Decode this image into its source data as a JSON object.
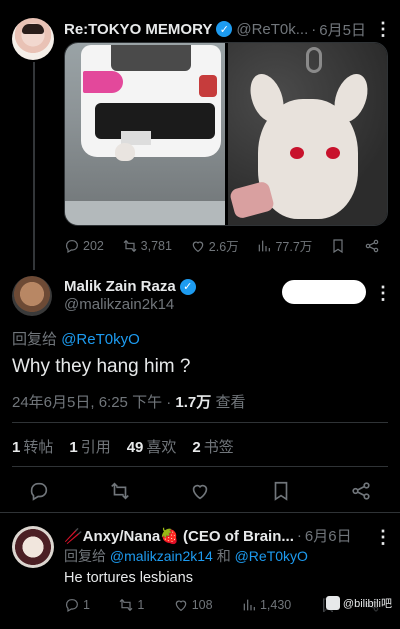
{
  "top_tweet": {
    "name": "Re:TOKYO MEMORY",
    "handle": "@ReT0k...",
    "date": "6月5日",
    "replies": "202",
    "retweets": "3,781",
    "likes": "2.6万",
    "views": "77.7万"
  },
  "main_tweet": {
    "name": "Malik Zain Raza",
    "handle": "@malikzain2k14",
    "reply_prefix": "回复给",
    "reply_to": "@ReT0kyO",
    "text": "Why they hang him ?",
    "timestamp": "24年6月5日, 6:25 下午",
    "views_count": "1.7万",
    "views_label": "查看",
    "stats": [
      {
        "count": "1",
        "label": "转帖"
      },
      {
        "count": "1",
        "label": "引用"
      },
      {
        "count": "49",
        "label": "喜欢"
      },
      {
        "count": "2",
        "label": "书签"
      }
    ]
  },
  "reply_tweet": {
    "name": "🥢Anxy/Nana🍓 (CEO of Brain...",
    "date": "6月6日",
    "reply_prefix": "回复给",
    "reply_to_1": "@malikzain2k14",
    "and": "和",
    "reply_to_2": "@ReT0kyO",
    "text": "He tortures lesbians",
    "replies": "1",
    "retweets": "1",
    "likes": "108",
    "views": "1,430"
  },
  "watermark": "@bilibili吧",
  "colors": {
    "background": "#000000",
    "accent": "#1d9bf0",
    "muted": "#71767b",
    "text": "#e7e9ea"
  }
}
